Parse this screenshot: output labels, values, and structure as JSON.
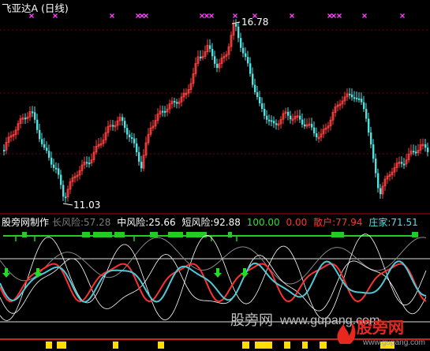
{
  "top_panel": {
    "title": "飞亚达A (日线)",
    "max_label": "16.78",
    "min_label": "11.03",
    "colors": {
      "up": "#ff4040",
      "down": "#4fe3e3",
      "marker": "#ff44ff",
      "title": "#ffffff"
    }
  },
  "indicator_panel": {
    "source": "股旁网制作",
    "stats": [
      {
        "label": "长风险:",
        "value": "57.28",
        "color": "#7c7c7c"
      },
      {
        "label": "中风险:",
        "value": "25.66",
        "color": "#ffffff"
      },
      {
        "label": "短风险:",
        "value": "92.88",
        "color": "#ffffff"
      },
      {
        "label": "",
        "value": "100.00",
        "color": "#33dd33"
      },
      {
        "label": "",
        "value": "0.00",
        "color": "#ff3333"
      },
      {
        "label": "散户:",
        "value": "77.94",
        "color": "#ff3333"
      },
      {
        "label": "庄家:",
        "value": "71.51",
        "color": "#4fe3e3"
      }
    ],
    "colors": {
      "bar_green": "#22cc22",
      "bar_yellow": "#ffdd00",
      "red_line": "#ff3030",
      "cyan_line": "#4fc8d8",
      "gray_line": "#888888",
      "white_line": "#ffffff",
      "arrow_green": "#22dd22"
    }
  },
  "watermark": {
    "site_cn": "股旁网",
    "site_en": "www.gupang.com",
    "logo_text": "股旁网",
    "logo_url": "www.gupang.com",
    "colors": {
      "text": "#bfbfbf",
      "logo": "#e8281e",
      "logo_url": "#9aa0a8"
    }
  }
}
